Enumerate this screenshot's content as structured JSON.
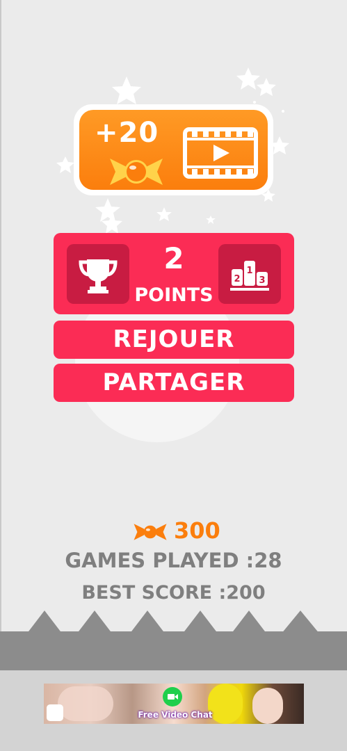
{
  "reward": {
    "amount": "+20",
    "candy_icon": "candy-icon",
    "video_icon": "video-play-icon"
  },
  "score": {
    "value": "2",
    "unit": "POINTS",
    "left_icon": "trophy-icon",
    "right_icon": "podium-icon",
    "podium_labels": [
      "2",
      "1",
      "3"
    ]
  },
  "buttons": {
    "replay": "REJOUER",
    "share": "PARTAGER"
  },
  "stats": {
    "candies": "300",
    "games_played": "GAMES PLAYED :28",
    "best_score": "BEST SCORE :200"
  },
  "ad": {
    "label": "Free Video Chat"
  },
  "colors": {
    "accent": "#fb2c55",
    "accent_dark": "#c81c42",
    "orange": "#fb7e0d",
    "ground": "#8c8c8c"
  }
}
